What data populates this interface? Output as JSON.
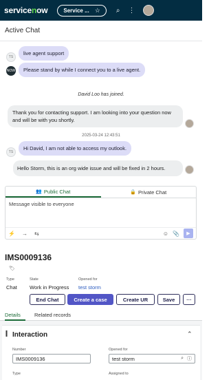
{
  "topbar": {
    "logo": "servicenow",
    "scope_label": "Service ...",
    "icons": [
      "star-icon",
      "search-icon",
      "more-vertical-icon",
      "avatar"
    ]
  },
  "header": {
    "title": "Active Chat"
  },
  "chat": {
    "messages": [
      {
        "sender_initials": "TS",
        "text": "live agent support"
      },
      {
        "sender_initials": "NOW",
        "text": "Please stand by while I connect you to a live agent."
      },
      {
        "system": "David Loo has joined."
      },
      {
        "text": "Thank you for contacting support. I am looking into your question now and will be with you shortly."
      },
      {
        "timestamp": "2025-03-24 12:43:51"
      },
      {
        "sender_initials": "TS",
        "text": "Hi David, I am not able to access my outlook."
      },
      {
        "text": "Hello Storm, this is an org wide issue and will be fixed in 2 hours."
      }
    ]
  },
  "composer": {
    "tabs": [
      "Public Chat",
      "Private Chat"
    ],
    "placeholder": "Message visible to everyone"
  },
  "record": {
    "number": "IMS0009136",
    "fields": {
      "type_label": "Type",
      "type_value": "Chat",
      "state_label": "State",
      "state_value": "Work in Progress",
      "opened_for_label": "Opened for",
      "opened_for_value": "test storm"
    },
    "buttons": [
      "End Chat",
      "Create a case",
      "Create UR",
      "Save",
      "···"
    ],
    "tabs": [
      "Details",
      "Related records"
    ]
  },
  "interaction": {
    "title": "Interaction",
    "number_label": "Number",
    "number_value": "IMS0009136",
    "opened_for_label": "Opened for",
    "opened_for_value": "test storm",
    "type_label": "Type",
    "assigned_to_label": "Assigned to"
  },
  "colors": {
    "topbar_bg": "#032d42",
    "accent_green": "#1c6b38",
    "primary_button": "#5256c6",
    "agent_bubble": "#dcdcf7",
    "customer_bubble": "#eceeef",
    "link": "#2b5bbf"
  }
}
